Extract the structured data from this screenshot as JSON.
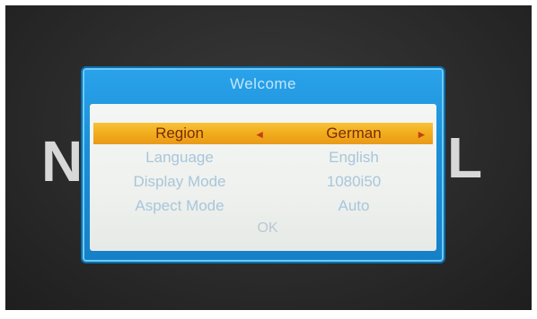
{
  "background": {
    "left_char": "N",
    "right_char": "L"
  },
  "dialog": {
    "title": "Welcome",
    "rows": [
      {
        "label": "Region",
        "value": "German",
        "selected": true
      },
      {
        "label": "Language",
        "value": "English",
        "selected": false
      },
      {
        "label": "Display Mode",
        "value": "1080i50",
        "selected": false
      },
      {
        "label": "Aspect Mode",
        "value": "Auto",
        "selected": false
      }
    ],
    "ok_label": "OK",
    "arrow_left": "◂",
    "arrow_right": "▸"
  },
  "colors": {
    "dialog_blue": "#1b8fd8",
    "highlight_orange": "#f2ad1a",
    "selected_text": "#7a2c08",
    "inactive_text": "#a9c6da"
  }
}
